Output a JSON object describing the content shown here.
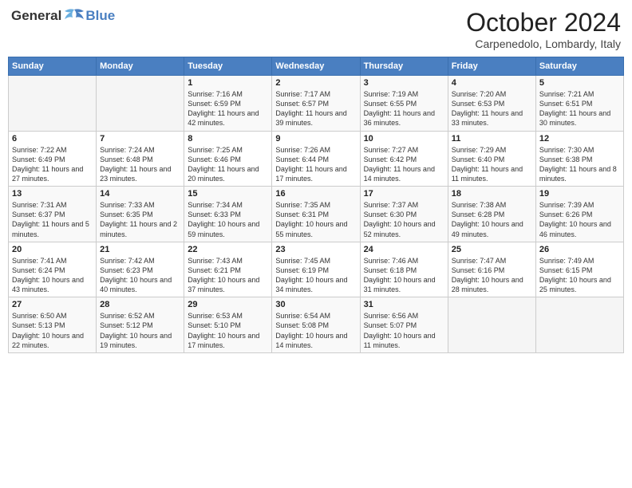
{
  "header": {
    "logo_general": "General",
    "logo_blue": "Blue",
    "month_title": "October 2024",
    "location": "Carpenedolo, Lombardy, Italy"
  },
  "weekdays": [
    "Sunday",
    "Monday",
    "Tuesday",
    "Wednesday",
    "Thursday",
    "Friday",
    "Saturday"
  ],
  "weeks": [
    [
      {
        "day": "",
        "info": ""
      },
      {
        "day": "",
        "info": ""
      },
      {
        "day": "1",
        "info": "Sunrise: 7:16 AM\nSunset: 6:59 PM\nDaylight: 11 hours and 42 minutes."
      },
      {
        "day": "2",
        "info": "Sunrise: 7:17 AM\nSunset: 6:57 PM\nDaylight: 11 hours and 39 minutes."
      },
      {
        "day": "3",
        "info": "Sunrise: 7:19 AM\nSunset: 6:55 PM\nDaylight: 11 hours and 36 minutes."
      },
      {
        "day": "4",
        "info": "Sunrise: 7:20 AM\nSunset: 6:53 PM\nDaylight: 11 hours and 33 minutes."
      },
      {
        "day": "5",
        "info": "Sunrise: 7:21 AM\nSunset: 6:51 PM\nDaylight: 11 hours and 30 minutes."
      }
    ],
    [
      {
        "day": "6",
        "info": "Sunrise: 7:22 AM\nSunset: 6:49 PM\nDaylight: 11 hours and 27 minutes."
      },
      {
        "day": "7",
        "info": "Sunrise: 7:24 AM\nSunset: 6:48 PM\nDaylight: 11 hours and 23 minutes."
      },
      {
        "day": "8",
        "info": "Sunrise: 7:25 AM\nSunset: 6:46 PM\nDaylight: 11 hours and 20 minutes."
      },
      {
        "day": "9",
        "info": "Sunrise: 7:26 AM\nSunset: 6:44 PM\nDaylight: 11 hours and 17 minutes."
      },
      {
        "day": "10",
        "info": "Sunrise: 7:27 AM\nSunset: 6:42 PM\nDaylight: 11 hours and 14 minutes."
      },
      {
        "day": "11",
        "info": "Sunrise: 7:29 AM\nSunset: 6:40 PM\nDaylight: 11 hours and 11 minutes."
      },
      {
        "day": "12",
        "info": "Sunrise: 7:30 AM\nSunset: 6:38 PM\nDaylight: 11 hours and 8 minutes."
      }
    ],
    [
      {
        "day": "13",
        "info": "Sunrise: 7:31 AM\nSunset: 6:37 PM\nDaylight: 11 hours and 5 minutes."
      },
      {
        "day": "14",
        "info": "Sunrise: 7:33 AM\nSunset: 6:35 PM\nDaylight: 11 hours and 2 minutes."
      },
      {
        "day": "15",
        "info": "Sunrise: 7:34 AM\nSunset: 6:33 PM\nDaylight: 10 hours and 59 minutes."
      },
      {
        "day": "16",
        "info": "Sunrise: 7:35 AM\nSunset: 6:31 PM\nDaylight: 10 hours and 55 minutes."
      },
      {
        "day": "17",
        "info": "Sunrise: 7:37 AM\nSunset: 6:30 PM\nDaylight: 10 hours and 52 minutes."
      },
      {
        "day": "18",
        "info": "Sunrise: 7:38 AM\nSunset: 6:28 PM\nDaylight: 10 hours and 49 minutes."
      },
      {
        "day": "19",
        "info": "Sunrise: 7:39 AM\nSunset: 6:26 PM\nDaylight: 10 hours and 46 minutes."
      }
    ],
    [
      {
        "day": "20",
        "info": "Sunrise: 7:41 AM\nSunset: 6:24 PM\nDaylight: 10 hours and 43 minutes."
      },
      {
        "day": "21",
        "info": "Sunrise: 7:42 AM\nSunset: 6:23 PM\nDaylight: 10 hours and 40 minutes."
      },
      {
        "day": "22",
        "info": "Sunrise: 7:43 AM\nSunset: 6:21 PM\nDaylight: 10 hours and 37 minutes."
      },
      {
        "day": "23",
        "info": "Sunrise: 7:45 AM\nSunset: 6:19 PM\nDaylight: 10 hours and 34 minutes."
      },
      {
        "day": "24",
        "info": "Sunrise: 7:46 AM\nSunset: 6:18 PM\nDaylight: 10 hours and 31 minutes."
      },
      {
        "day": "25",
        "info": "Sunrise: 7:47 AM\nSunset: 6:16 PM\nDaylight: 10 hours and 28 minutes."
      },
      {
        "day": "26",
        "info": "Sunrise: 7:49 AM\nSunset: 6:15 PM\nDaylight: 10 hours and 25 minutes."
      }
    ],
    [
      {
        "day": "27",
        "info": "Sunrise: 6:50 AM\nSunset: 5:13 PM\nDaylight: 10 hours and 22 minutes."
      },
      {
        "day": "28",
        "info": "Sunrise: 6:52 AM\nSunset: 5:12 PM\nDaylight: 10 hours and 19 minutes."
      },
      {
        "day": "29",
        "info": "Sunrise: 6:53 AM\nSunset: 5:10 PM\nDaylight: 10 hours and 17 minutes."
      },
      {
        "day": "30",
        "info": "Sunrise: 6:54 AM\nSunset: 5:08 PM\nDaylight: 10 hours and 14 minutes."
      },
      {
        "day": "31",
        "info": "Sunrise: 6:56 AM\nSunset: 5:07 PM\nDaylight: 10 hours and 11 minutes."
      },
      {
        "day": "",
        "info": ""
      },
      {
        "day": "",
        "info": ""
      }
    ]
  ]
}
